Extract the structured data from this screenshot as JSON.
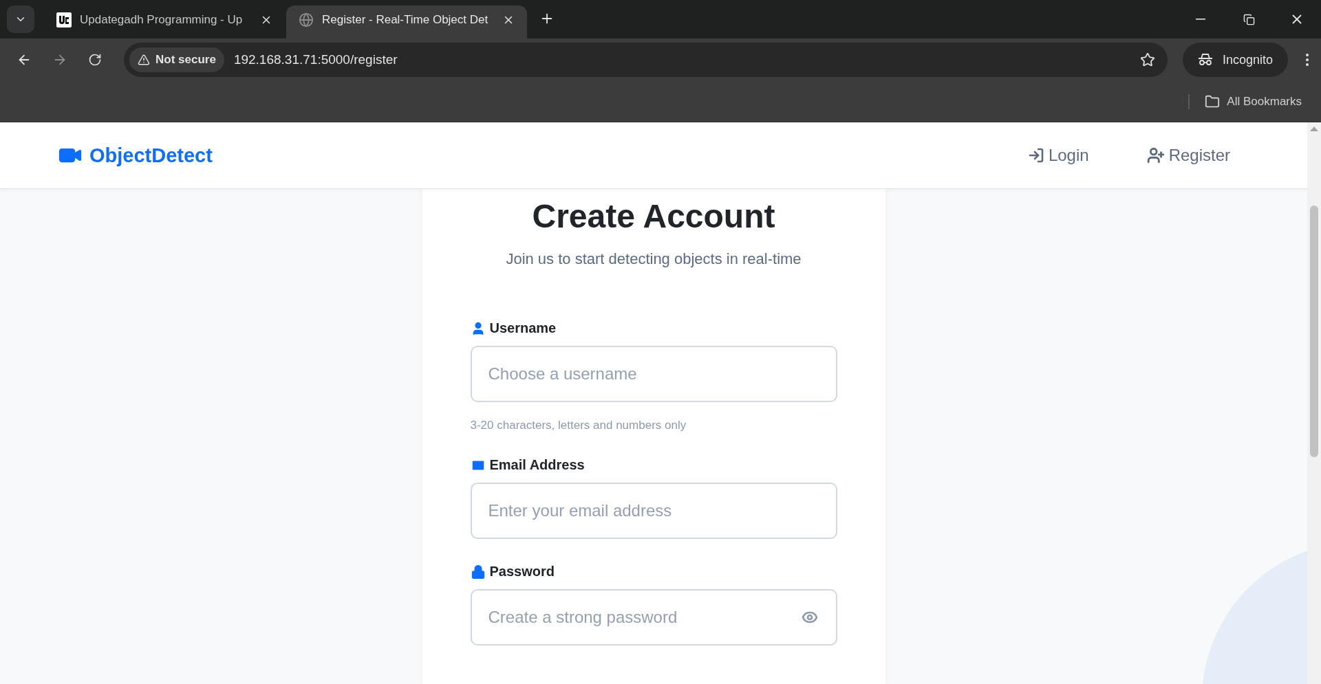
{
  "browser": {
    "tabs": [
      {
        "title": "Updategadh Programming - Up",
        "selected": false
      },
      {
        "title": "Register - Real-Time Object Det",
        "selected": true
      }
    ],
    "security_label": "Not secure",
    "url": "192.168.31.71:5000/register",
    "profile_label": "Incognito",
    "bookmarks_label": "All Bookmarks"
  },
  "navbar": {
    "brand": "ObjectDetect",
    "links": [
      {
        "label": "Login"
      },
      {
        "label": "Register"
      }
    ]
  },
  "form": {
    "title": "Create Account",
    "subtitle": "Join us to start detecting objects in real-time",
    "fields": [
      {
        "label": "Username",
        "kind": "text",
        "placeholder": "Choose a username",
        "hint": "3-20 characters, letters and numbers only"
      },
      {
        "label": "Email Address",
        "kind": "email",
        "placeholder": "Enter your email address"
      },
      {
        "label": "Password",
        "placeholder": "Create a strong password",
        "kind": "password"
      }
    ]
  }
}
